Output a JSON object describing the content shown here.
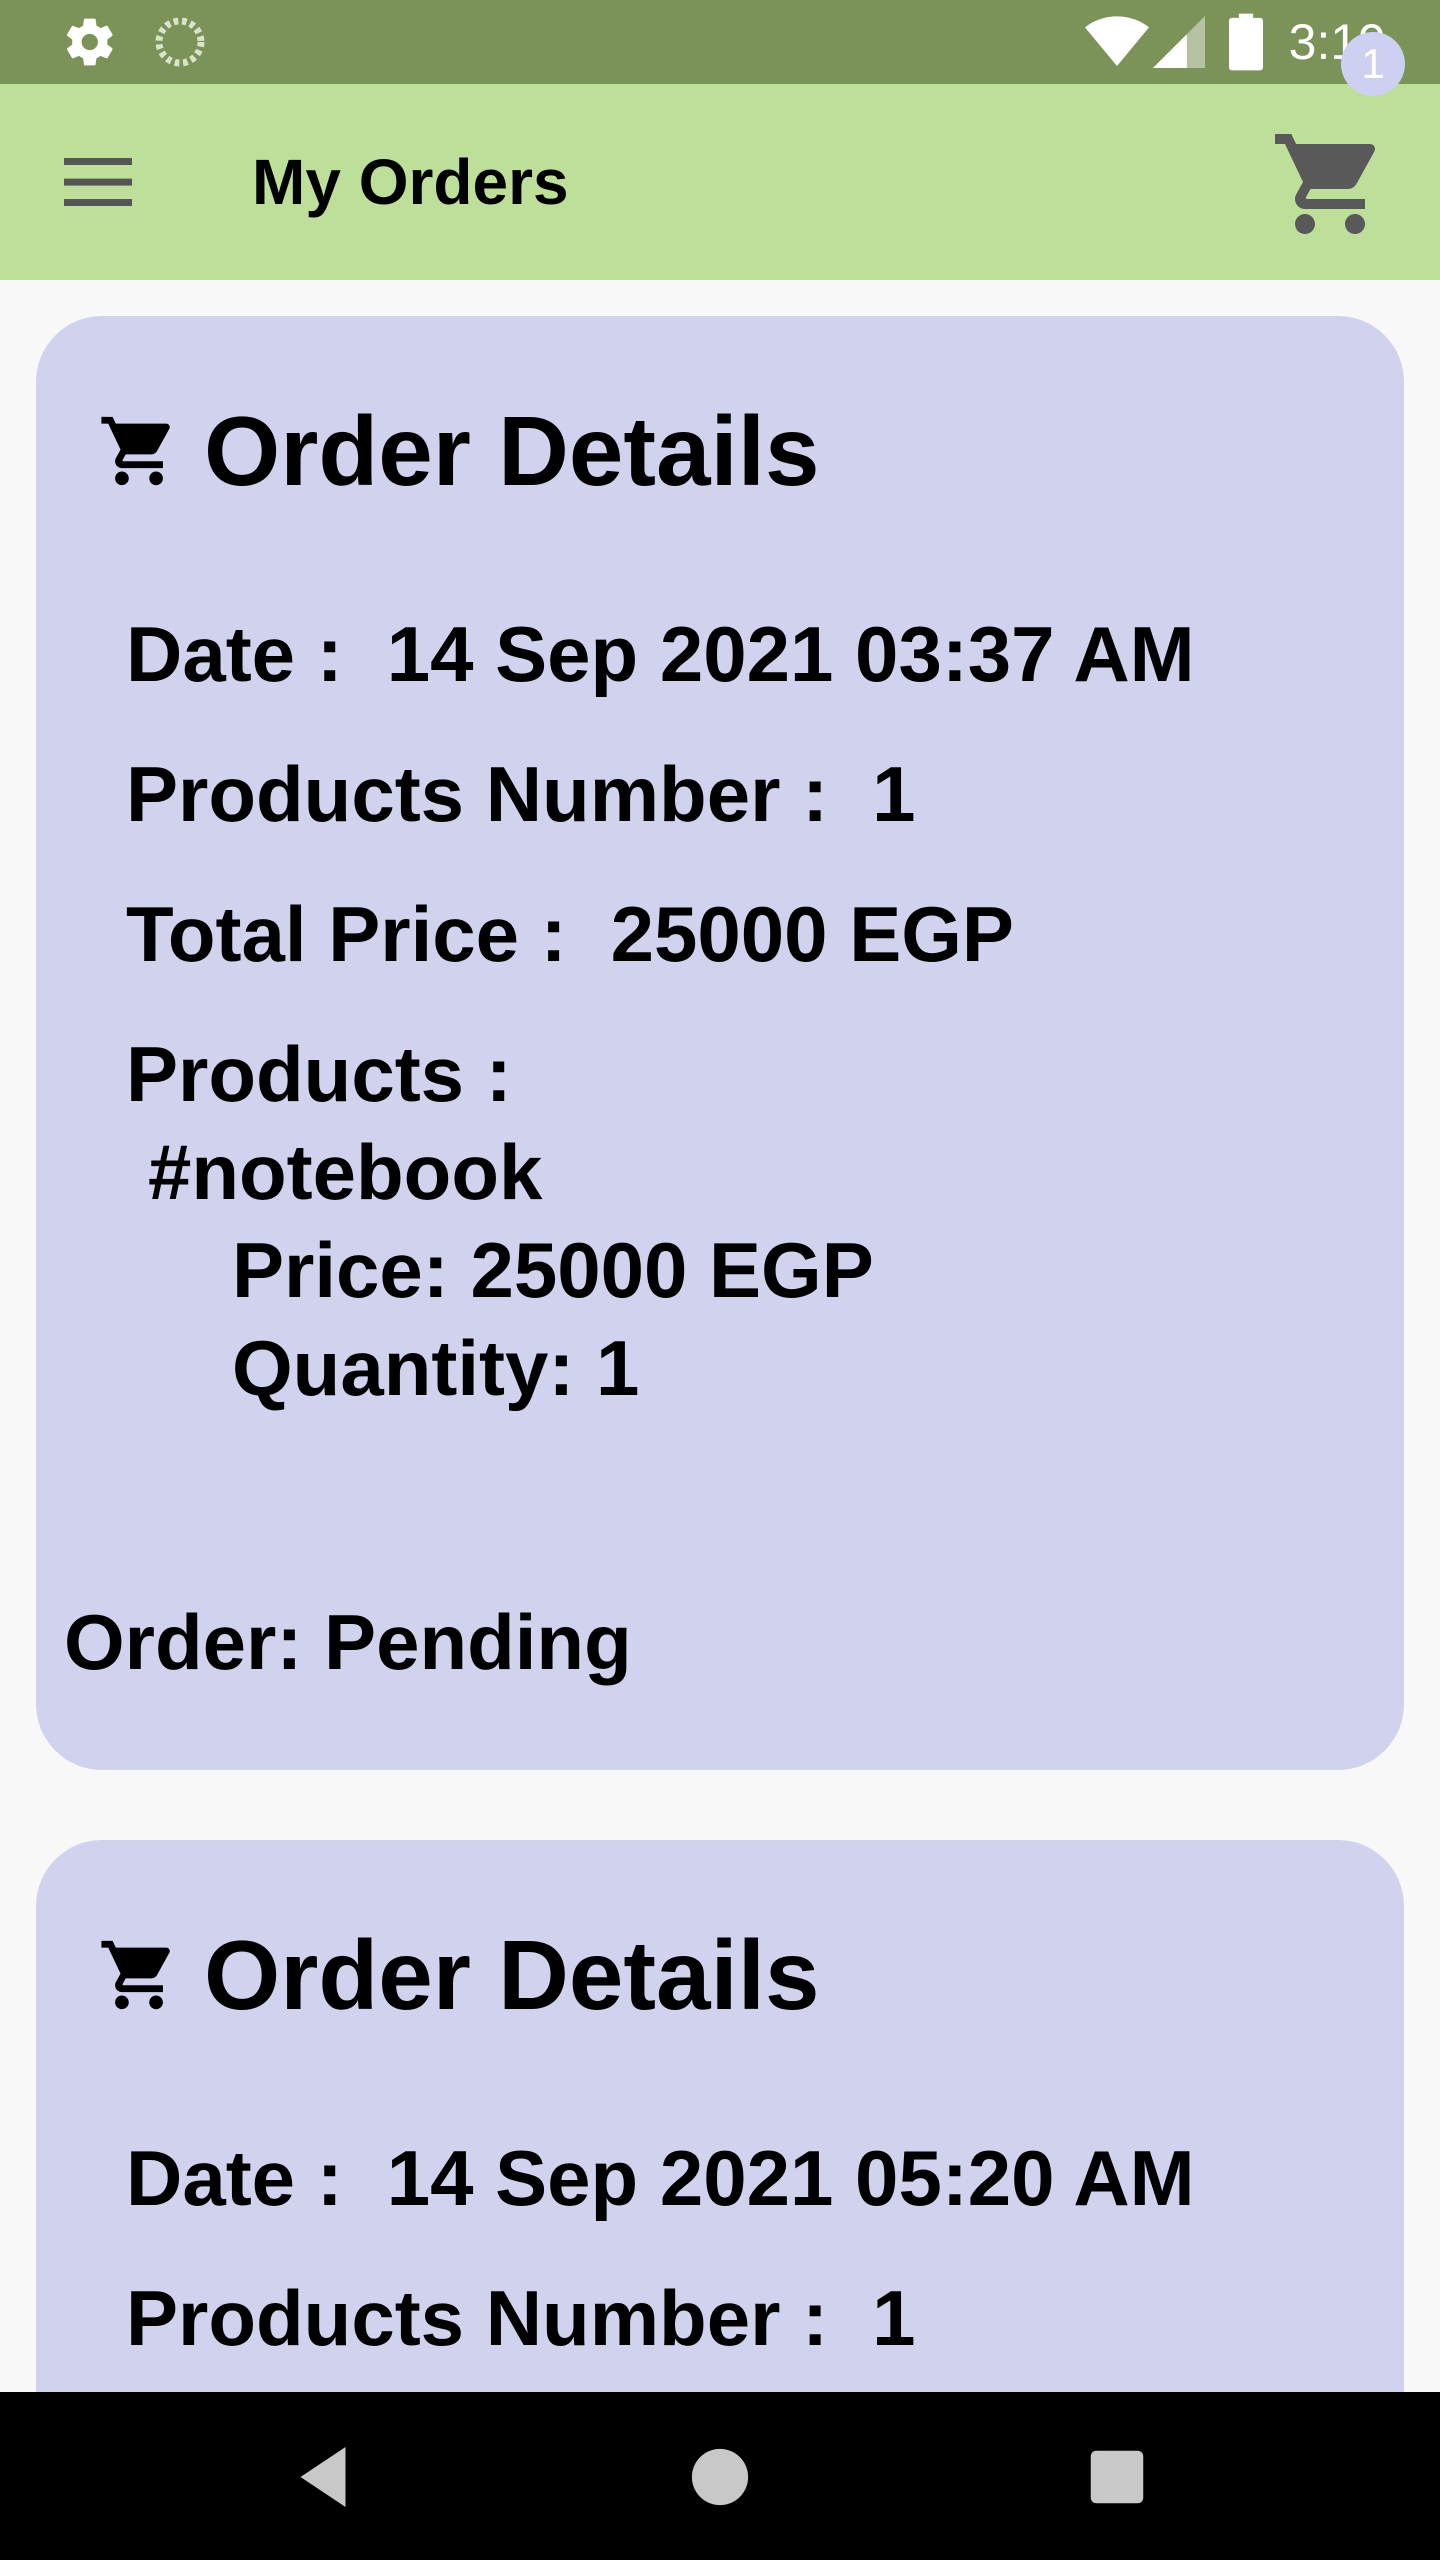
{
  "status_bar": {
    "time": "3:19",
    "icons": [
      "gear-icon",
      "loading-icon",
      "wifi-icon",
      "signal-icon",
      "battery-icon"
    ],
    "background": "#7b9358"
  },
  "app_bar": {
    "title": "My Orders",
    "cart_badge_count": "1",
    "background": "#bedf99",
    "badge_color": "#cdd0f0"
  },
  "orders": [
    {
      "title": "Order Details",
      "date_label": "Date :",
      "date_value": "14 Sep 2021 03:37 AM",
      "products_number_label": "Products Number :",
      "products_number_value": "1",
      "total_price_label": "Total Price :",
      "total_price_value": "25000 EGP",
      "products_label": "Products :",
      "products": [
        {
          "name": "#notebook",
          "price_line": "Price: 25000 EGP",
          "quantity_line": "Quantity: 1"
        }
      ],
      "status": "Order: Pending"
    },
    {
      "title": "Order Details",
      "date_label": "Date :",
      "date_value": "14 Sep 2021 05:20 AM",
      "products_number_label": "Products Number :",
      "products_number_value": "1"
    }
  ],
  "card_color": "#d0d2ee",
  "nav_bar": {
    "buttons": [
      "back-icon",
      "home-icon",
      "recent-apps-icon"
    ]
  }
}
